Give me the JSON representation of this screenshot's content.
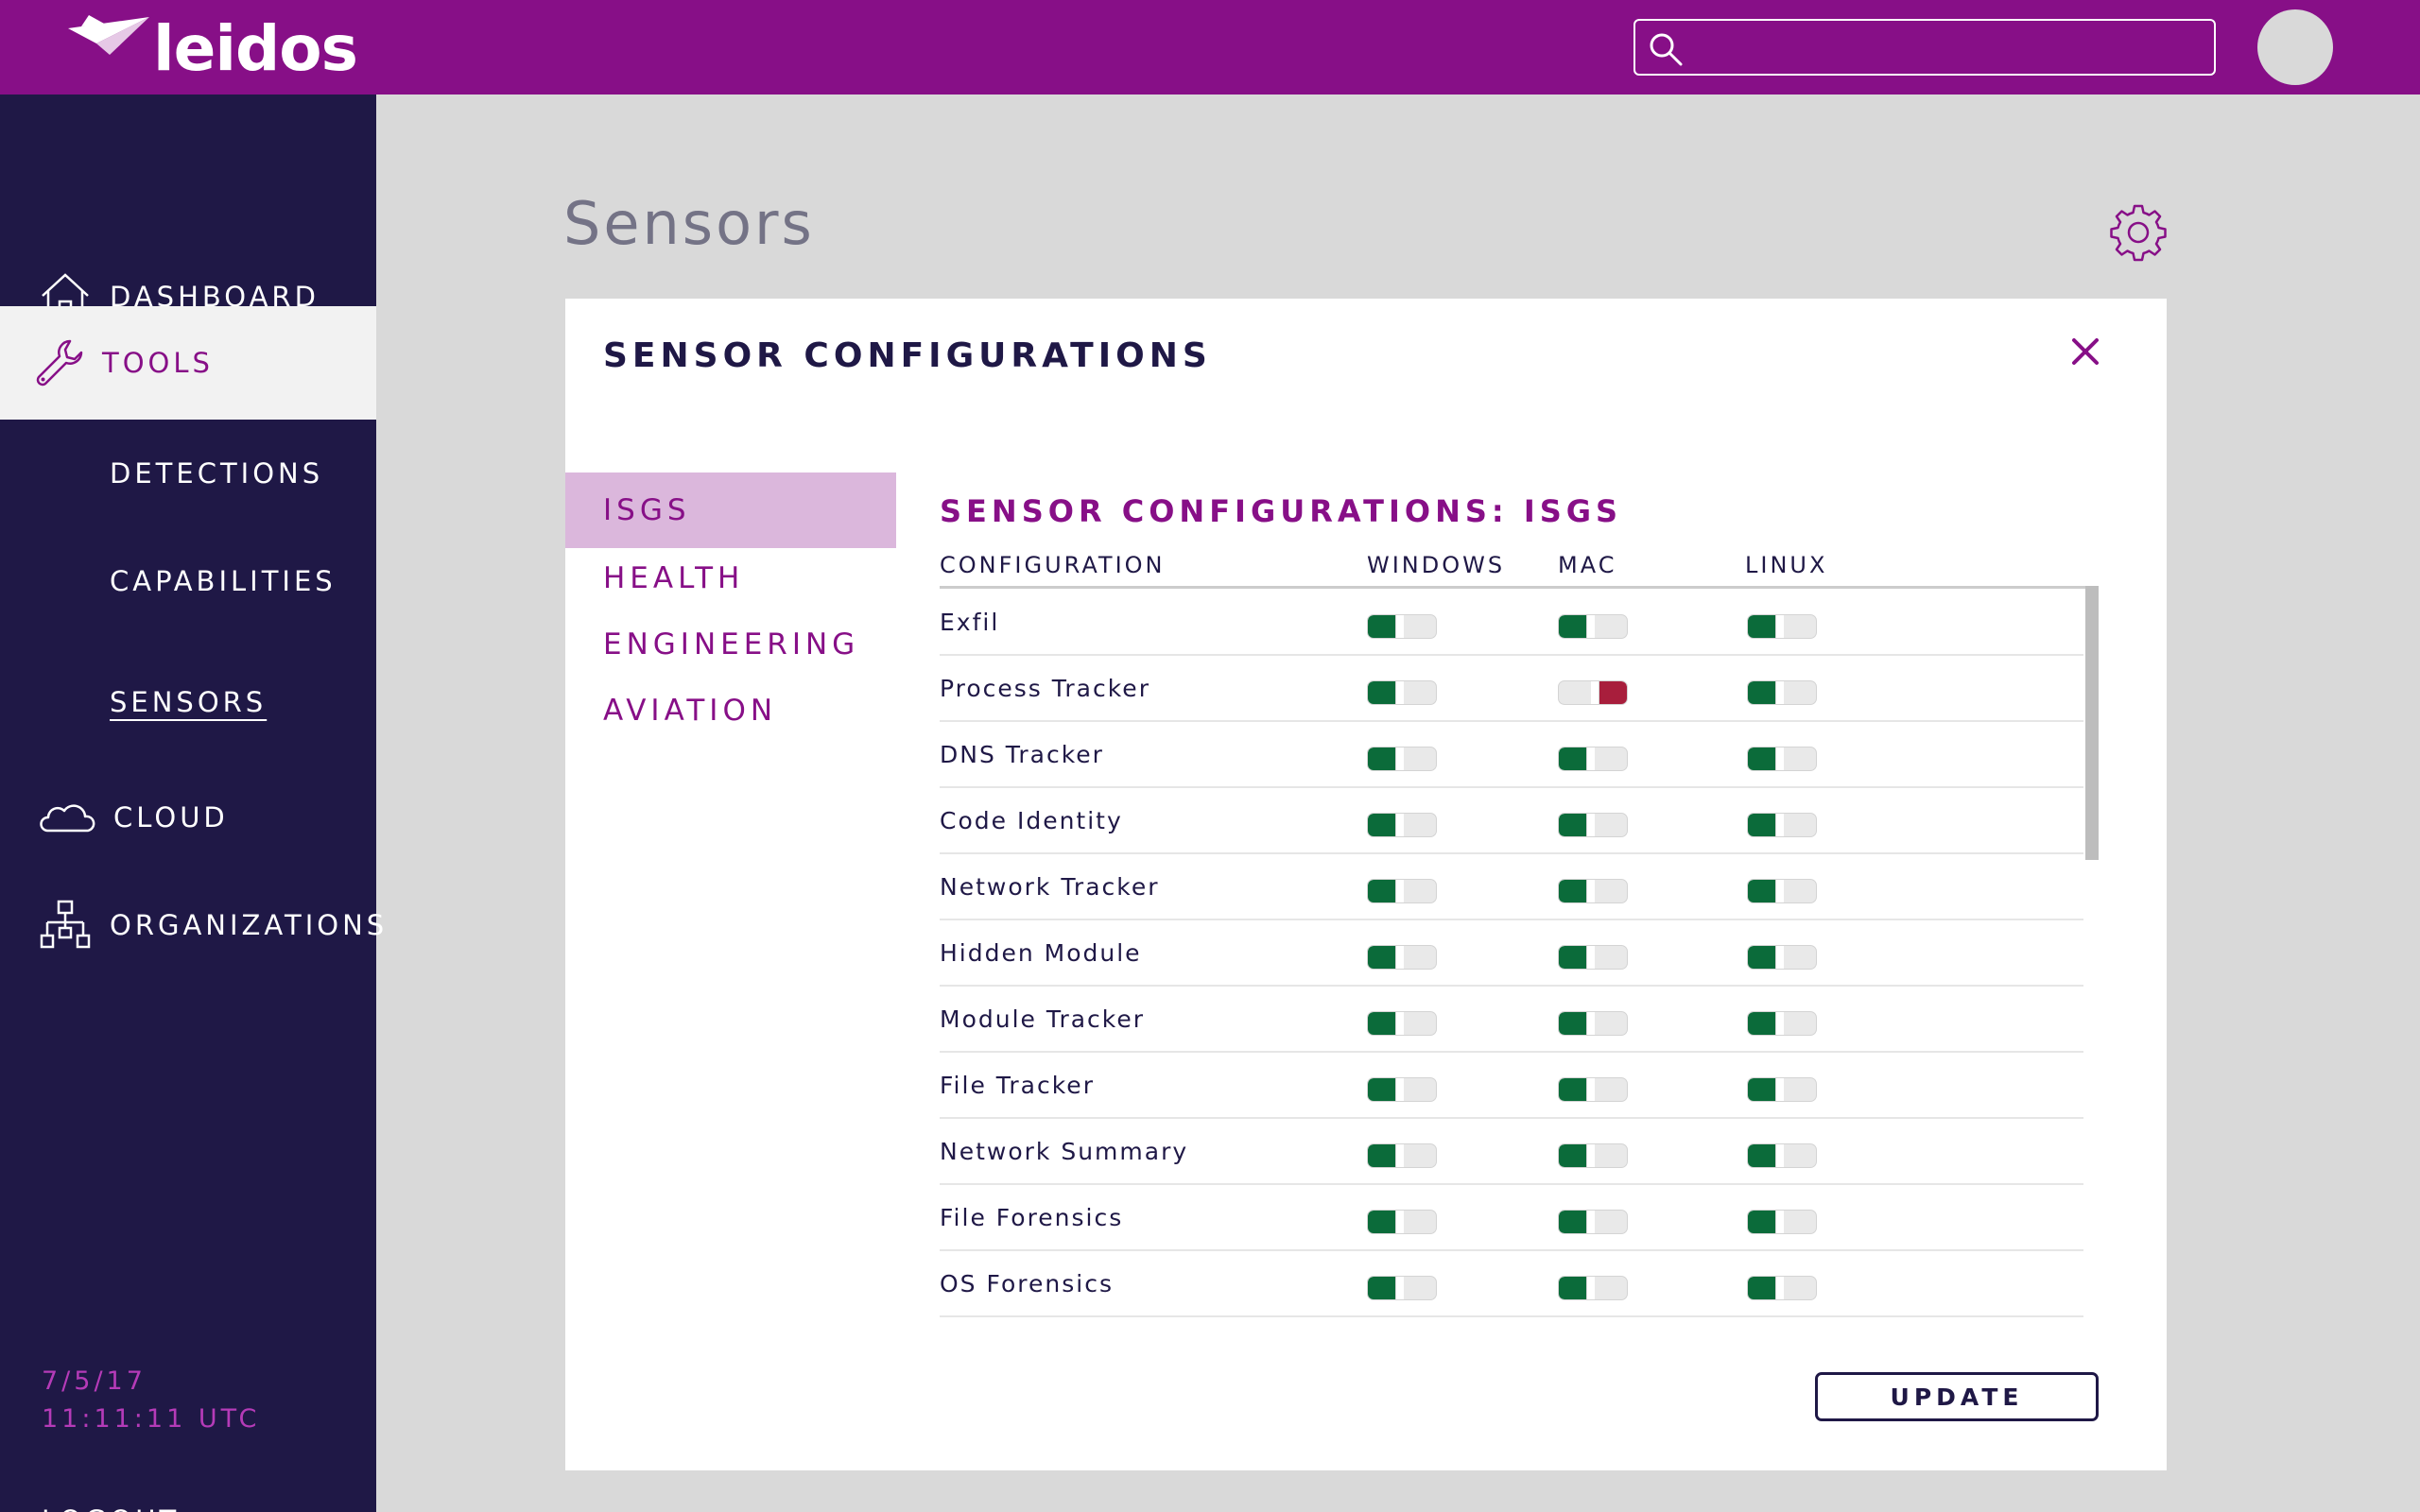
{
  "brand": {
    "logo_text": "leidos",
    "logo_icon": "paper-plane-icon"
  },
  "header": {
    "search_placeholder": "",
    "search_icon": "search-icon"
  },
  "sidebar": {
    "items": [
      {
        "label": "DASHBOARD",
        "icon": "home-icon"
      },
      {
        "label": "TOOLS",
        "icon": "wrench-icon",
        "active": true
      },
      {
        "label": "CLOUD",
        "icon": "cloud-icon"
      },
      {
        "label": "ORGANIZATIONS",
        "icon": "org-chart-icon"
      }
    ],
    "sub_items": [
      {
        "label": "DETECTIONS"
      },
      {
        "label": "CAPABILITIES"
      },
      {
        "label": "SENSORS",
        "current": true
      }
    ],
    "date": "7/5/17",
    "time": "11:11:11 UTC",
    "logout": "LOGOUT"
  },
  "page": {
    "title": "Sensors",
    "settings_icon": "gear-icon"
  },
  "panel": {
    "title": "SENSOR CONFIGURATIONS",
    "close_icon": "close-icon",
    "tabs": [
      {
        "label": "ISGS",
        "active": true
      },
      {
        "label": "HEALTH"
      },
      {
        "label": "ENGINEERING"
      },
      {
        "label": "AVIATION"
      }
    ],
    "section_title": "SENSOR CONFIGURATIONS: ISGS",
    "columns": [
      "CONFIGURATION",
      "WINDOWS",
      "MAC",
      "LINUX"
    ],
    "rows": [
      {
        "name": "Exfil",
        "windows": true,
        "mac": true,
        "linux": true
      },
      {
        "name": "Process Tracker",
        "windows": true,
        "mac": false,
        "linux": true
      },
      {
        "name": "DNS Tracker",
        "windows": true,
        "mac": true,
        "linux": true
      },
      {
        "name": "Code Identity",
        "windows": true,
        "mac": true,
        "linux": true
      },
      {
        "name": "Network Tracker",
        "windows": true,
        "mac": true,
        "linux": true
      },
      {
        "name": "Hidden Module",
        "windows": true,
        "mac": true,
        "linux": true
      },
      {
        "name": "Module Tracker",
        "windows": true,
        "mac": true,
        "linux": true
      },
      {
        "name": "File Tracker",
        "windows": true,
        "mac": true,
        "linux": true
      },
      {
        "name": "Network Summary",
        "windows": true,
        "mac": true,
        "linux": true
      },
      {
        "name": "File Forensics",
        "windows": true,
        "mac": true,
        "linux": true
      },
      {
        "name": "OS Forensics",
        "windows": true,
        "mac": true,
        "linux": true
      }
    ],
    "update_label": "UPDATE"
  },
  "colors": {
    "brand_purple": "#870f87",
    "sidebar_navy": "#1f1846",
    "toggle_on": "#0b6b3a",
    "toggle_off": "#a81e3c",
    "tab_active_bg": "#dbb7dc"
  }
}
